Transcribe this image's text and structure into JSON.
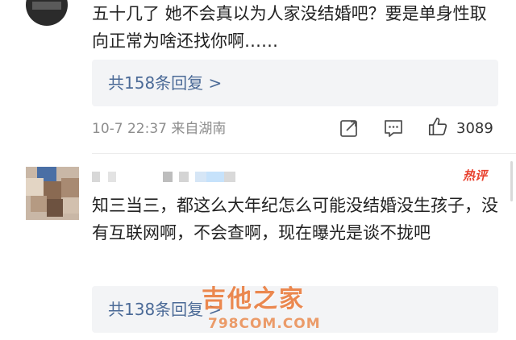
{
  "comments": [
    {
      "text": "五十几了 她不会真以为人家没结婚吧？要是单身性取向正常为啥还找你啊……",
      "replies_label": "共158条回复 >",
      "date": "10-7 22:37",
      "location": "来自湖南",
      "like_count": "3089"
    },
    {
      "badge": "热评",
      "text": "知三当三，都这么大年纪怎么可能没结婚没生孩子，没有互联网啊，不会查啊，现在曝光是谈不拢吧",
      "replies_label": "共138条回复 >"
    }
  ],
  "icons": {
    "share": "share-icon",
    "comment": "comment-icon",
    "like": "thumbs-up-icon"
  },
  "watermark": {
    "name": "吉他之家",
    "site": "798COM.COM"
  },
  "colors": {
    "link": "#4b6a97",
    "meta": "#8d8d8d",
    "hot": "#e8412e",
    "reply_bg": "#f3f4f6"
  }
}
